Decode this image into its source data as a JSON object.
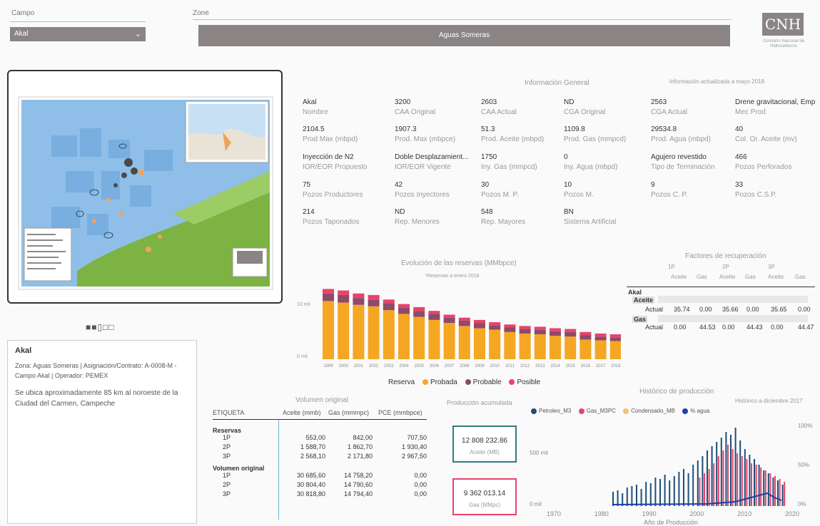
{
  "filters": {
    "campo_label": "Campo",
    "campo_value": "Akal",
    "zone_label": "Zone",
    "zone_value": "Aguas Someras"
  },
  "logo": {
    "text": "CNH",
    "subtitle": "Comisión Nacional de Hidrocarburos"
  },
  "pager": {
    "symbols": "■■▯□□"
  },
  "info": {
    "title": "Información General",
    "updated": "Información actualizada a mayo 2018",
    "rows": [
      [
        {
          "v": "Akal",
          "k": "Nombre"
        },
        {
          "v": "3200",
          "k": "CAA Original"
        },
        {
          "v": "2603",
          "k": "CAA Actual"
        },
        {
          "v": "ND",
          "k": "CGA Original"
        },
        {
          "v": "2563",
          "k": "CGA Actual"
        },
        {
          "v": "Drene gravitacional, Empu...",
          "k": "Mec Prod"
        }
      ],
      [
        {
          "v": "2104.5",
          "k": "Prod Max (mbpd)"
        },
        {
          "v": "1907.3",
          "k": "Prod. Max (mbpce)"
        },
        {
          "v": "51.3",
          "k": "Prod. Aceite (mbpd)"
        },
        {
          "v": "1109.8",
          "k": "Prod. Gas (mmpcd)"
        },
        {
          "v": "29534.8",
          "k": "Prod. Agua (mbpd)"
        },
        {
          "v": "40",
          "k": "Col. Or. Aceite (mv)"
        }
      ],
      [
        {
          "v": "Inyección de N2",
          "k": "IOR/EOR Propuesto"
        },
        {
          "v": "Doble Desplazamient...",
          "k": "IOR/EOR Vigente"
        },
        {
          "v": "1750",
          "k": "Iny. Gas (mmpcd)"
        },
        {
          "v": "0",
          "k": "Iny. Agua (mbpd)"
        },
        {
          "v": "Agujero revestido",
          "k": "Tipo de Terminación"
        },
        {
          "v": "466",
          "k": "Pozos Perforados"
        }
      ],
      [
        {
          "v": "75",
          "k": "Pozos Productores"
        },
        {
          "v": "42",
          "k": "Pozos Inyectores"
        },
        {
          "v": "30",
          "k": "Pozos M. P."
        },
        {
          "v": "10",
          "k": "Pozos M."
        },
        {
          "v": "9",
          "k": "Pozos C. P."
        },
        {
          "v": "33",
          "k": "Pozos C.S.P."
        }
      ],
      [
        {
          "v": "214",
          "k": "Pozos Taponados"
        },
        {
          "v": "ND",
          "k": "Rep. Menores"
        },
        {
          "v": "548",
          "k": "Rep. Mayores"
        },
        {
          "v": "BN",
          "k": "Sistema Artificial"
        }
      ]
    ]
  },
  "reserves_chart": {
    "title": "Evolución de las reservas (MMbpce)",
    "subtitle": "*Reservas a enero 2018",
    "ytick_top": "10 mil",
    "ytick_bottom": "0 mil",
    "legend_title": "Reserva",
    "colors": {
      "probada": "#f5a623",
      "probable": "#8e4a6b",
      "posible": "#e8436a"
    }
  },
  "chart_data": [
    {
      "type": "bar",
      "title": "Evolución de las reservas (MMbpce)",
      "subtitle": "*Reservas a enero 2018",
      "categories": [
        "1999",
        "2000",
        "2001",
        "2002",
        "2003",
        "2004",
        "2005",
        "2006",
        "2007",
        "2008",
        "2009",
        "2010",
        "2011",
        "2012",
        "2013",
        "2014",
        "2015",
        "2016",
        "2017",
        "2018"
      ],
      "series": [
        {
          "name": "Probada",
          "values": [
            7.7,
            7.5,
            7.2,
            7.0,
            6.5,
            6.0,
            5.6,
            5.2,
            4.8,
            4.4,
            4.1,
            3.9,
            3.6,
            3.4,
            3.3,
            3.1,
            3.0,
            2.6,
            2.5,
            2.4
          ]
        },
        {
          "name": "Probable",
          "values": [
            1.0,
            1.0,
            0.9,
            0.9,
            0.9,
            0.8,
            0.8,
            0.8,
            0.7,
            0.7,
            0.7,
            0.6,
            0.6,
            0.6,
            0.6,
            0.6,
            0.6,
            0.6,
            0.5,
            0.5
          ]
        },
        {
          "name": "Posible",
          "values": [
            0.6,
            0.6,
            0.6,
            0.6,
            0.5,
            0.5,
            0.5,
            0.4,
            0.4,
            0.4,
            0.4,
            0.4,
            0.4,
            0.4,
            0.4,
            0.4,
            0.4,
            0.4,
            0.4,
            0.4
          ]
        }
      ],
      "ylim": [
        0,
        10
      ],
      "legend": "bottom"
    },
    {
      "type": "bar",
      "title": "Histórico de producción",
      "subtitle": "Histórico a diciembre 2017",
      "x_ticks": [
        "1970",
        "1980",
        "1990",
        "2000",
        "2010",
        "2020"
      ],
      "y_ticks_left": [
        "0 mil",
        "500 mil"
      ],
      "y_ticks_right": [
        "0%",
        "50%",
        "100%"
      ],
      "xlabel": "Año de Producción",
      "series": [
        {
          "name": "Petroleo_M3",
          "color": "#1f4e79"
        },
        {
          "name": "Gas_M3PC",
          "color": "#e8436a"
        },
        {
          "name": "Condensado_MB",
          "color": "#f5c07a"
        },
        {
          "name": "% agua",
          "color": "#1c3faa"
        }
      ],
      "legend": "top"
    }
  ],
  "recovery": {
    "title": "Factores de recuperación",
    "groups": [
      "1P",
      "2P",
      "3P"
    ],
    "cols": [
      "Aceite",
      "Gas",
      "Aceite",
      "Gas",
      "Aceite",
      "Gas"
    ],
    "field": "Akal",
    "aceite_label": "Aceite",
    "gas_label": "Gas",
    "actual_label": "Actual",
    "aceite_actual": [
      "35.74",
      "0.00",
      "35.66",
      "0.00",
      "35.65",
      "0.00"
    ],
    "gas_actual": [
      "0.00",
      "44.53",
      "0.00",
      "44.43",
      "0.00",
      "44.47"
    ]
  },
  "description": {
    "title": "Akal",
    "line1": "Zona: Aguas Someras | Asignación/Contrato: A-0008-M - Campo Akal | Operador: PEMEX",
    "line2": "Se ubica aproximadamente 85 km al noroeste de la Ciudad del Carmen, Campeche"
  },
  "volume": {
    "title": "Volumen original",
    "headers": [
      "ETIQUETA",
      "Aceite (mmb)",
      "Gas (mmmpc)",
      "PCE (mmbpce)"
    ],
    "section1": "Reservas",
    "section2": "Volumen original",
    "rows1": [
      [
        "1P",
        "553,00",
        "842,00",
        "707,50"
      ],
      [
        "2P",
        "1 588,70",
        "1 862,70",
        "1 930,40"
      ],
      [
        "3P",
        "2 568,10",
        "2 171,80",
        "2 967,50"
      ]
    ],
    "rows2": [
      [
        "1P",
        "30 685,60",
        "14 758,20",
        "0,00"
      ],
      [
        "2P",
        "30 804,40",
        "14 790,60",
        "0,00"
      ],
      [
        "3P",
        "30 818,80",
        "14 794,40",
        "0,00"
      ]
    ]
  },
  "cumulative": {
    "title": "Producción acumulada",
    "oil_value": "12 808 232.86",
    "oil_label": "Aceite (MB)",
    "gas_value": "9 362 013.14",
    "gas_label": "Gas (MMpc)"
  }
}
